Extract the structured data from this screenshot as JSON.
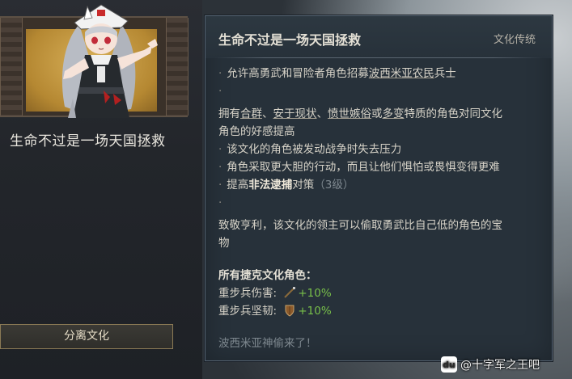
{
  "left_panel": {
    "title": "生命不过是一场天国拯救",
    "button_label": "分离文化"
  },
  "tooltip": {
    "title": "生命不过是一场天国拯救",
    "tag": "文化传统",
    "line1_pre": "允许高勇武和冒险者角色招募",
    "line1_link": "波西米亚农民",
    "line1_post": "兵士",
    "line2_a": "拥有",
    "line2_t1": "合群",
    "line2_sep1": "、",
    "line2_t2": "安于现状",
    "line2_sep2": "、",
    "line2_t3": "愤世嫉俗",
    "line2_sep3": "或",
    "line2_t4": "多变",
    "line2_b": "特质的角色对同文化",
    "line3": "角色的好感提高",
    "line4": "该文化的角色被发动战争时失去压力",
    "line5": "角色采取更大胆的行动，而且让他们惧怕或畏惧变得更难",
    "line6_pre": "提高",
    "line6_bold": "非法逮捕",
    "line6_post": "对策",
    "line6_level": "（3级）",
    "line7": "致敬亨利，该文化的领主可以偷取勇武比自己低的角色的宝",
    "line8": "物",
    "section_head": "所有捷克文化角色：",
    "stat1_label": "重步兵伤害:",
    "stat1_value": "+10%",
    "stat2_label": "重步兵坚韧:",
    "stat2_value": "+10%",
    "quote": "波西米亚神偷来了！"
  },
  "icons": {
    "stat1": "spear-icon",
    "stat2": "shield-icon",
    "bullet": "bullet-dot"
  },
  "watermark": {
    "text": "@十字军之王吧",
    "logo_text": "du"
  },
  "colors": {
    "bonus_green": "#79c14a",
    "tooltip_bg": "#27313a",
    "button_border": "#8b7a55"
  }
}
